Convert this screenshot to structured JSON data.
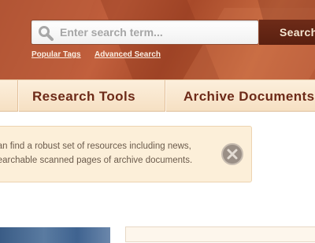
{
  "header": {
    "search": {
      "placeholder": "Enter search term...",
      "button_label": "Search"
    },
    "links": {
      "popular_tags": "Popular Tags",
      "advanced_search": "Advanced Search"
    }
  },
  "nav": {
    "items": [
      {
        "label": "Research Tools"
      },
      {
        "label": "Archive Documents"
      }
    ]
  },
  "info": {
    "line1": "can find a robust set of resources including news,",
    "line2": "searchable scanned pages of archive documents."
  },
  "icons": {
    "search": "magnifier-icon",
    "close": "close-x-icon"
  },
  "colors": {
    "banner": "#b5563a",
    "nav_text": "#6d2a18",
    "nav_bg": "#fcefdc",
    "search_button": "#5f2413",
    "info_bg": "#fcefd9"
  }
}
